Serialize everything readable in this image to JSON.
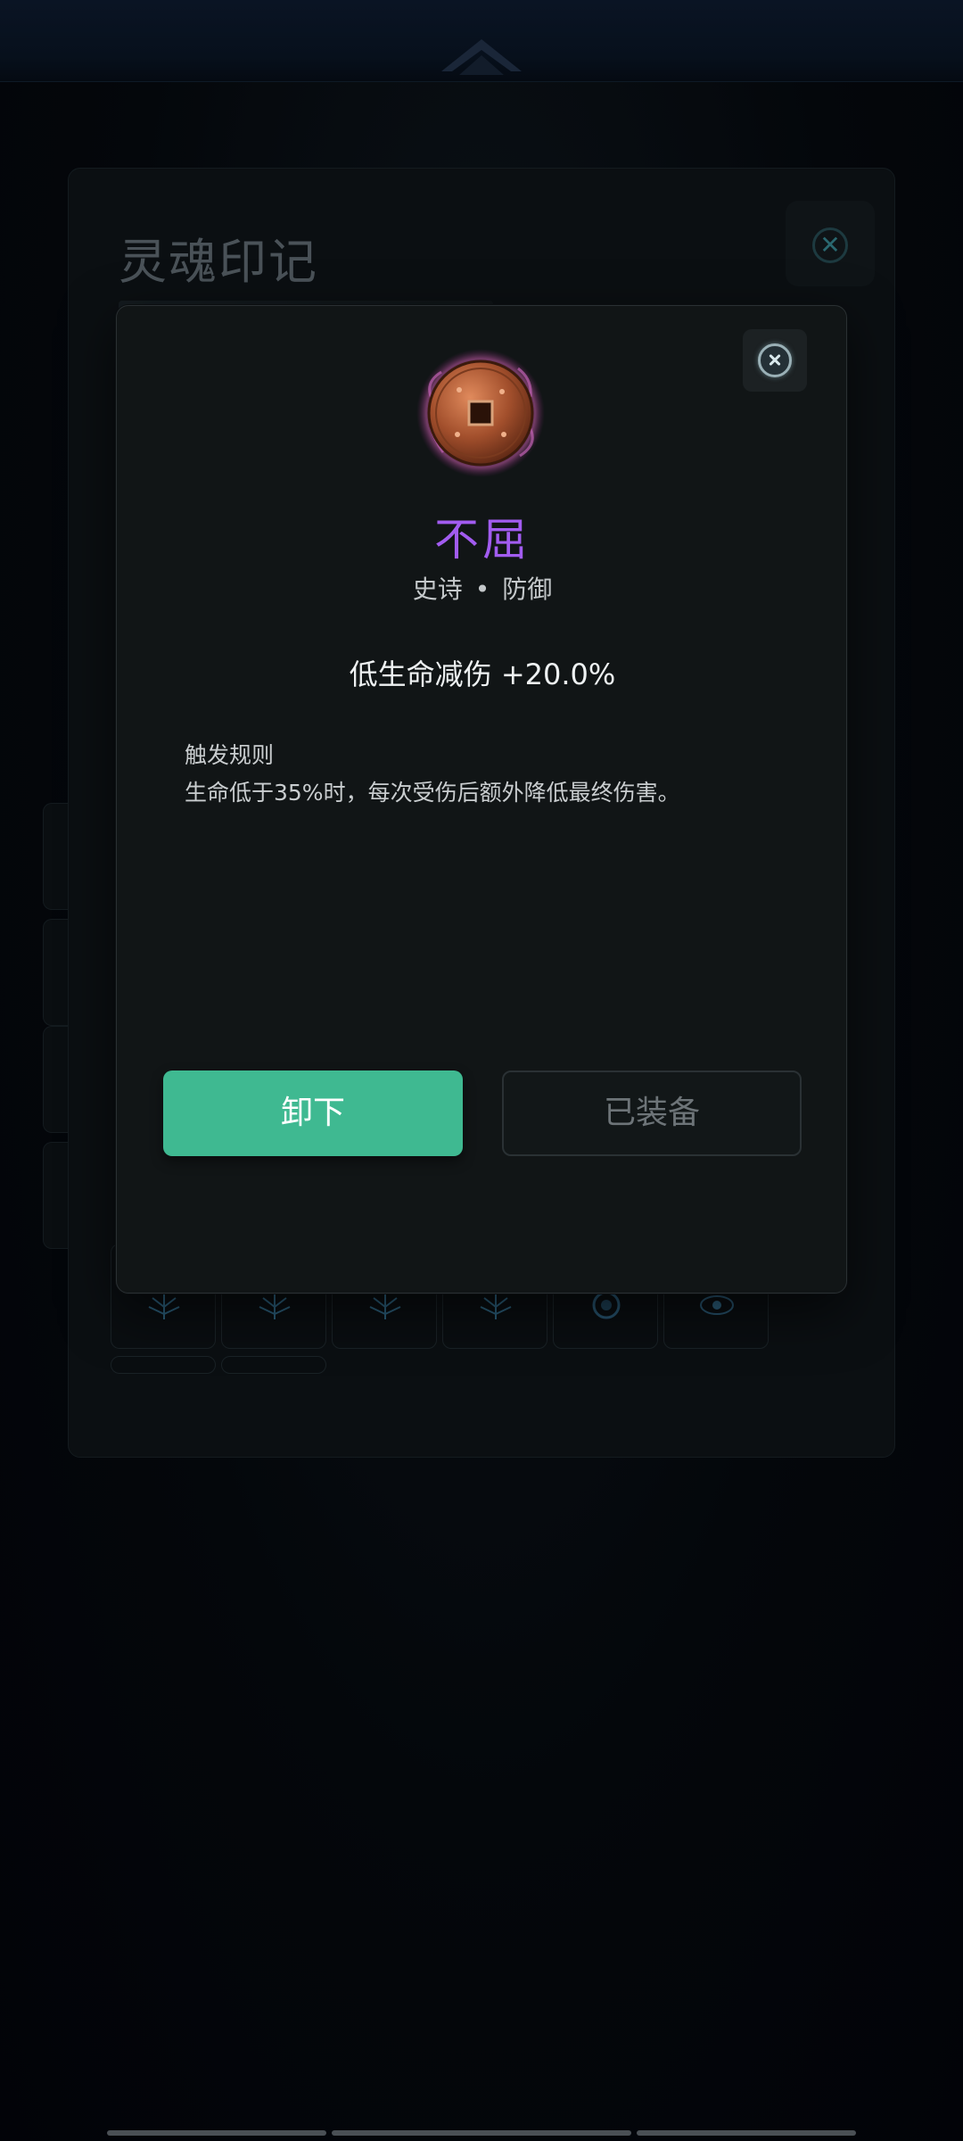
{
  "panel": {
    "title": "灵魂印记"
  },
  "modal": {
    "item_name": "不屈",
    "rarity": "史诗",
    "separator": "•",
    "category": "防御",
    "stat": "低生命减伤 +20.0%",
    "rule_title": "触发规则",
    "rule_text": "生命低于35%时，每次受伤后额外降低最终伤害。",
    "primary_button": "卸下",
    "secondary_button": "已装备",
    "item_icon": "bronze-coin-icon",
    "close_icon": "close-icon"
  },
  "colors": {
    "accent_green": "#3fb991",
    "epic_purple": "#a25cf0",
    "modal_bg": "#111516"
  }
}
